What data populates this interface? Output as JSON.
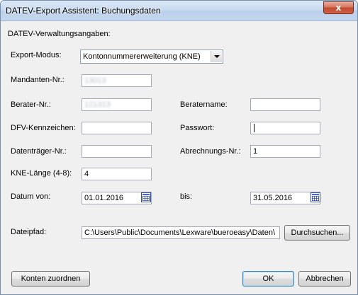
{
  "window": {
    "title": "DATEV-Export Assistent: Buchungsdaten",
    "close_glyph": "x"
  },
  "section": {
    "heading": "DATEV-Verwaltungsangaben:"
  },
  "export_mode": {
    "label": "Export-Modus:",
    "value": "Kontonnummererweiterung (KNE)"
  },
  "mandant": {
    "label": "Mandanten-Nr.:",
    "value": "13013"
  },
  "berater": {
    "label": "Berater-Nr.:",
    "value": "121313"
  },
  "beratername": {
    "label": "Beratername:",
    "value": ""
  },
  "dfv": {
    "label": "DFV-Kennzeichen:",
    "value": ""
  },
  "passwort": {
    "label": "Passwort:",
    "value": ""
  },
  "datentraeger": {
    "label": "Datenträger-Nr.:",
    "value": ""
  },
  "abrechnung": {
    "label": "Abrechnungs-Nr.:",
    "value": "1"
  },
  "kne": {
    "label": "KNE-Länge (4-8):",
    "value": "4"
  },
  "datum_von": {
    "label": "Datum von:",
    "value": "01.01.2016"
  },
  "datum_bis": {
    "label": "bis:",
    "value": "31.05.2016"
  },
  "dateipfad": {
    "label": "Dateipfad:",
    "value": "C:\\Users\\Public\\Documents\\Lexware\\bueroeasy\\Daten\\"
  },
  "buttons": {
    "browse": "Durchsuchen...",
    "assign_accounts": "Konten zuordnen",
    "ok": "OK",
    "cancel": "Abbrechen"
  },
  "icons": {
    "calendar": "calendar-icon",
    "dropdown": "chevron-down-icon",
    "close": "close-icon"
  },
  "colors": {
    "titlebar": "#c7d9ef",
    "close_button": "#c04a2b",
    "calendar_icon": "#2e49b8",
    "default_button_border": "#3c7fb1"
  }
}
